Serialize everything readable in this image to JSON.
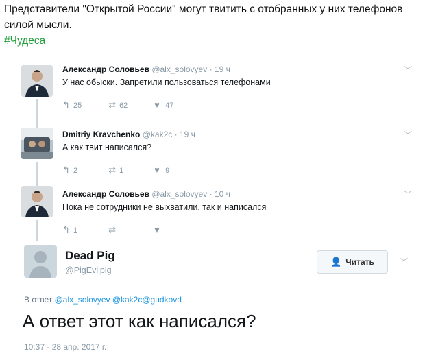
{
  "caption": {
    "text": "Представители \"Открытой России\" могут твитить с отобранных у них телефонов силой мысли.",
    "hashtag": "#Чудеса"
  },
  "tweets": [
    {
      "name": "Александр Соловьев",
      "handle": "@alx_solovyev",
      "time": "· 19 ч",
      "text": "У нас обыски. Запретили пользоваться телефонами",
      "replies": "25",
      "retweets": "62",
      "likes": "47"
    },
    {
      "name": "Dmitriy Kravchenko",
      "handle": "@kak2c",
      "time": "· 19 ч",
      "text": "А как твит написался?",
      "replies": "2",
      "retweets": "1",
      "likes": "9"
    },
    {
      "name": "Александр Соловьев",
      "handle": "@alx_solovyev",
      "time": "· 10 ч",
      "text": "Пока не сотрудники не выхватили, так и написался",
      "replies": "1",
      "retweets": "",
      "likes": ""
    }
  ],
  "main_tweet": {
    "name": "Dead Pig",
    "handle": "@PigEvilpig",
    "follow_label": "Читать",
    "reply_prefix": "В ответ",
    "mentions": "@alx_solovyev @kak2c@gudkovd",
    "text": "А ответ этот как написался?",
    "timestamp": "10:37 - 28 апр. 2017 г."
  },
  "icons": {
    "reply": "reply-icon",
    "retweet": "retweet-icon",
    "like": "heart-icon",
    "more": "chevron-down-icon",
    "follow": "follow-user-icon"
  },
  "colors": {
    "hashtag": "#1f9e3c",
    "link": "#1b95e0",
    "muted": "#8899a6"
  }
}
